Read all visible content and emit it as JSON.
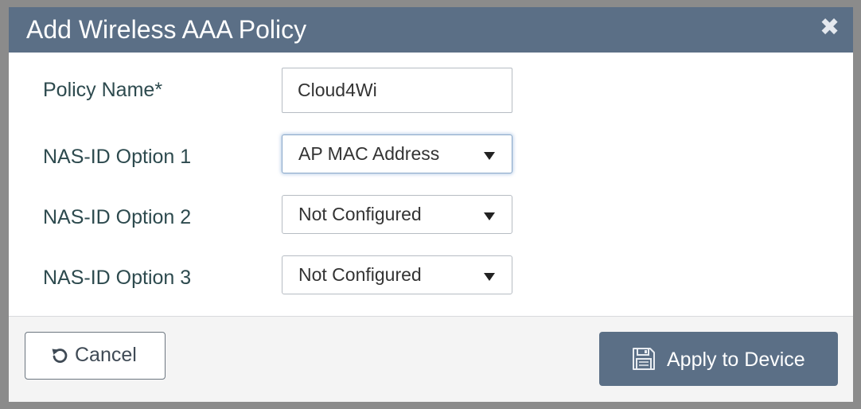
{
  "dialog": {
    "title": "Add Wireless AAA Policy",
    "close_icon": "close-icon"
  },
  "form": {
    "policy_name": {
      "label": "Policy Name*",
      "value": "Cloud4Wi"
    },
    "nas_id_option_1": {
      "label": "NAS-ID Option 1",
      "selected": "AP MAC Address"
    },
    "nas_id_option_2": {
      "label": "NAS-ID Option 2",
      "selected": "Not Configured"
    },
    "nas_id_option_3": {
      "label": "NAS-ID Option 3",
      "selected": "Not Configured"
    }
  },
  "footer": {
    "cancel_label": "Cancel",
    "cancel_icon": "undo-icon",
    "apply_label": "Apply to Device",
    "apply_icon": "save-icon"
  },
  "colors": {
    "header_bg": "#5b6f86",
    "primary_button": "#5b6f86",
    "label_text": "#2d4a4e",
    "backdrop": "#8b8b8b"
  }
}
